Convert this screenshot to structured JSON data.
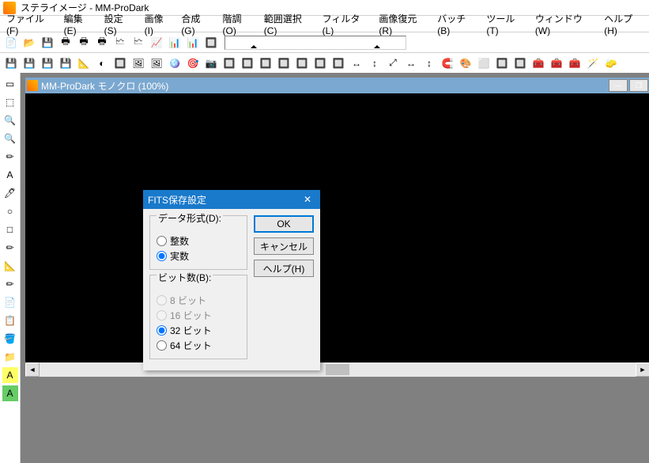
{
  "app": {
    "title": "ステライメージ  - MM-ProDark"
  },
  "menu": [
    "ファイル(F)",
    "編集(E)",
    "設定(S)",
    "画像(I)",
    "合成(G)",
    "階調(O)",
    "範囲選択(C)",
    "フィルタ(L)",
    "画像復元(R)",
    "バッチ(B)",
    "ツール(T)",
    "ウィンドウ(W)",
    "ヘルプ(H)"
  ],
  "document": {
    "title": "MM-ProDark モノクロ (100%)"
  },
  "dialog": {
    "title": "FITS保存設定",
    "groups": {
      "data_format": {
        "legend": "データ形式(D):",
        "options": [
          "整数",
          "実数"
        ],
        "selected": 1
      },
      "bit_depth": {
        "legend": "ビット数(B):",
        "options": [
          "8 ビット",
          "16 ビット",
          "32 ビット",
          "64 ビット"
        ],
        "disabled": [
          0,
          1
        ],
        "selected": 2
      }
    },
    "buttons": {
      "ok": "OK",
      "cancel": "キャンセル",
      "help": "ヘルプ(H)"
    }
  },
  "icons": {
    "side": [
      "▭",
      "⬚",
      "🔍",
      "🔍",
      "✏",
      "A",
      "🖊",
      "○",
      "□",
      "✏",
      "📐",
      "✏",
      "📄",
      "📋",
      "🪣",
      "📁",
      "A",
      "A"
    ],
    "row1": [
      "📄",
      "📂",
      "💾",
      "🖶",
      "🖶",
      "🖶",
      "🗠",
      "🗠",
      "📈",
      "📊",
      "📊",
      "🔲"
    ],
    "row2": [
      "💾",
      "💾",
      "💾",
      "💾",
      "📐",
      "◐",
      "🔲",
      "🖼",
      "🖼",
      "🪩",
      "🎯",
      "📷",
      "🔲",
      "🔲",
      "🔲",
      "🔲",
      "🔲",
      "🔲",
      "🔲",
      "↔",
      "↕",
      "⤢",
      "↔",
      "↕",
      "🧲",
      "🎨",
      "⬜",
      "🔲",
      "🔲",
      "🧰",
      "🧰",
      "🧰",
      "🪄",
      "🧽"
    ]
  }
}
